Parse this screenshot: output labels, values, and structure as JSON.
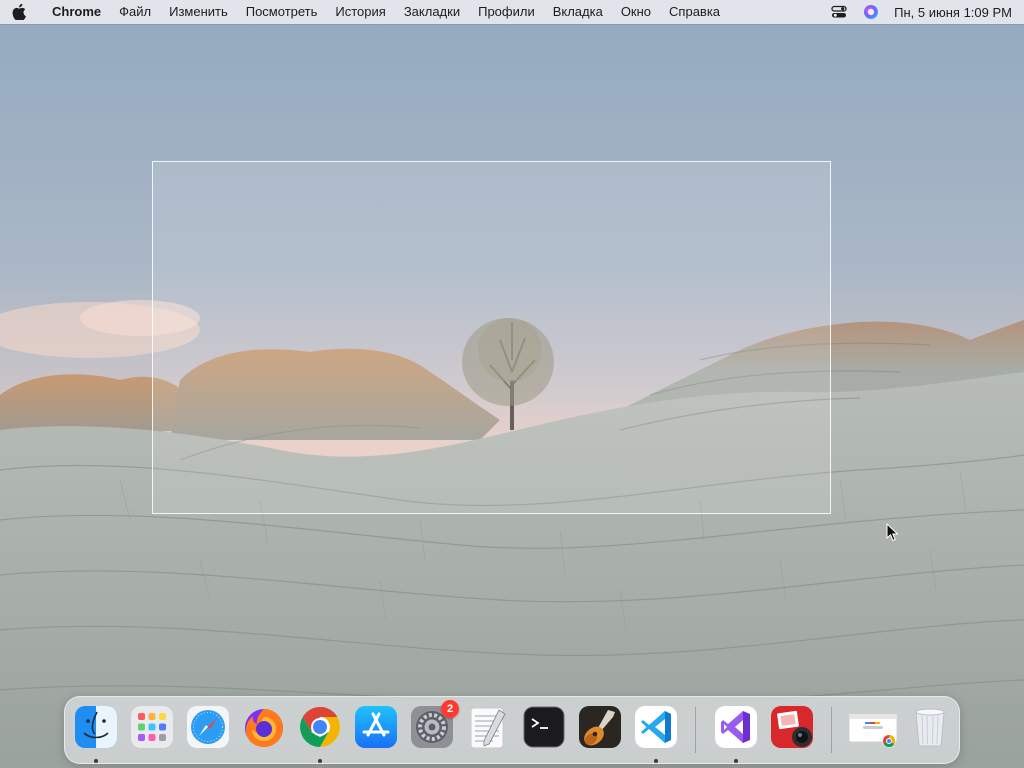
{
  "menubar": {
    "app_name": "Chrome",
    "items": [
      "Файл",
      "Изменить",
      "Посмотреть",
      "История",
      "Закладки",
      "Профили",
      "Вкладка",
      "Окно",
      "Справка"
    ],
    "clock": "Пн, 5 июня  1:09 PM",
    "status_icons": [
      "control-center-icon",
      "siri-icon"
    ]
  },
  "dock": {
    "apps": [
      {
        "name": "finder",
        "running": true
      },
      {
        "name": "launchpad",
        "running": false
      },
      {
        "name": "safari",
        "running": false
      },
      {
        "name": "firefox",
        "running": false
      },
      {
        "name": "chrome",
        "running": true
      },
      {
        "name": "app-store",
        "running": false
      },
      {
        "name": "system-preferences",
        "running": false,
        "badge": "2"
      },
      {
        "name": "textedit",
        "running": false
      },
      {
        "name": "terminal",
        "running": false
      },
      {
        "name": "garageband",
        "running": false
      },
      {
        "name": "vscode",
        "running": true
      },
      {
        "name": "visual-studio",
        "running": true
      },
      {
        "name": "photo-booth",
        "running": false
      },
      {
        "name": "chrome-window-preview",
        "running": false
      },
      {
        "name": "trash",
        "running": false
      }
    ]
  },
  "colors": {
    "sky_top": "#9aafc3",
    "sky_horizon": "#efcbc0",
    "rock": "#aeb5b0",
    "badge": "#ff3b30"
  }
}
